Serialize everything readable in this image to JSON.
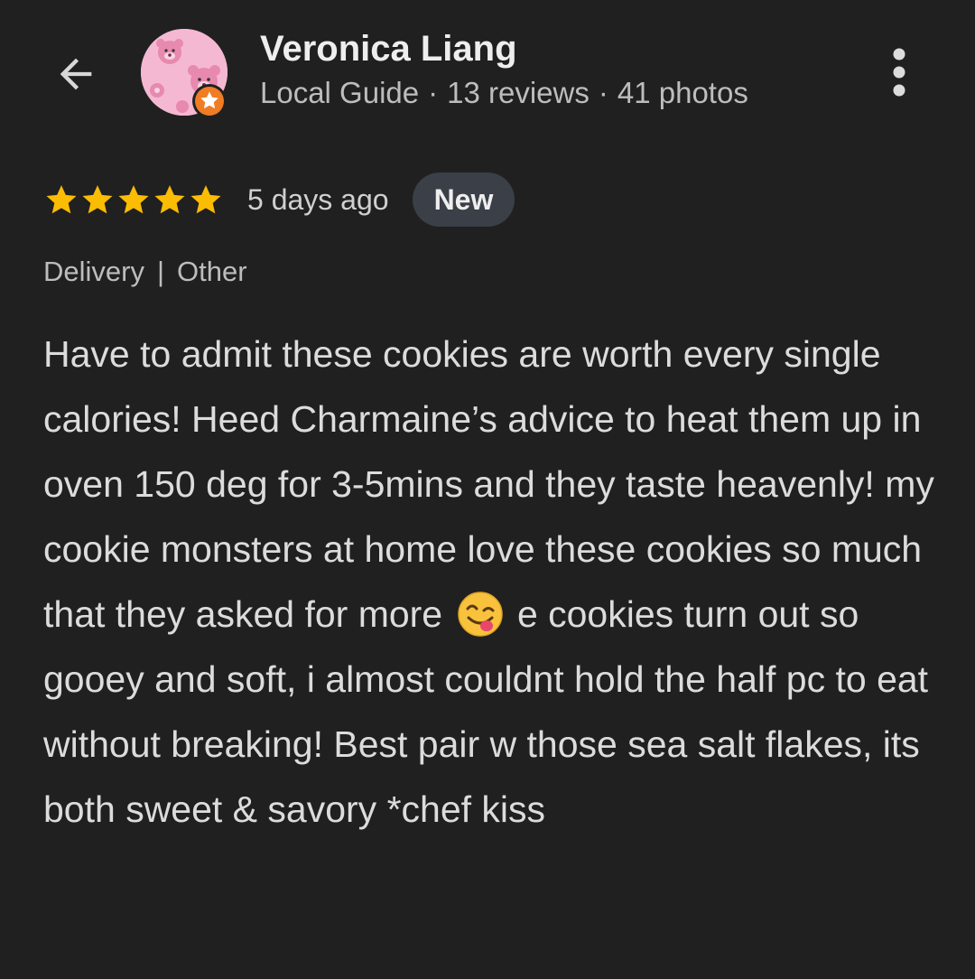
{
  "header": {
    "back_icon": "arrow-back-icon",
    "reviewer": {
      "name": "Veronica Liang",
      "level": "Local Guide",
      "reviews": "13 reviews",
      "photos": "41 photos",
      "separator": "·",
      "avatar_icon": "pink-bear-avatar",
      "badge_icon": "local-guide-star-badge"
    },
    "more_icon": "more-vertical-icon"
  },
  "review": {
    "rating": 5,
    "max_rating": 5,
    "time_ago": "5 days ago",
    "badge": "New",
    "tags": [
      "Delivery",
      "Other"
    ],
    "tag_separator": "|",
    "text_before_emoji": "Have to admit these cookies are worth every single calories! Heed Charmaine’s advice to heat them up in oven 150 deg for 3-5mins and they taste heavenly! my cookie monsters at home love these cookies so much that they asked for more",
    "emoji": "face-savoring-food-emoji",
    "text_after_emoji": "e cookies turn out so gooey and soft, i almost couldnt hold the half pc to eat without breaking! Best pair w those sea salt flakes, its both sweet & savory *chef kiss"
  },
  "colors": {
    "background": "#202020",
    "star": "#fbbc04",
    "badge_bg": "#3a3f48",
    "guide_badge": "#f07c24"
  }
}
